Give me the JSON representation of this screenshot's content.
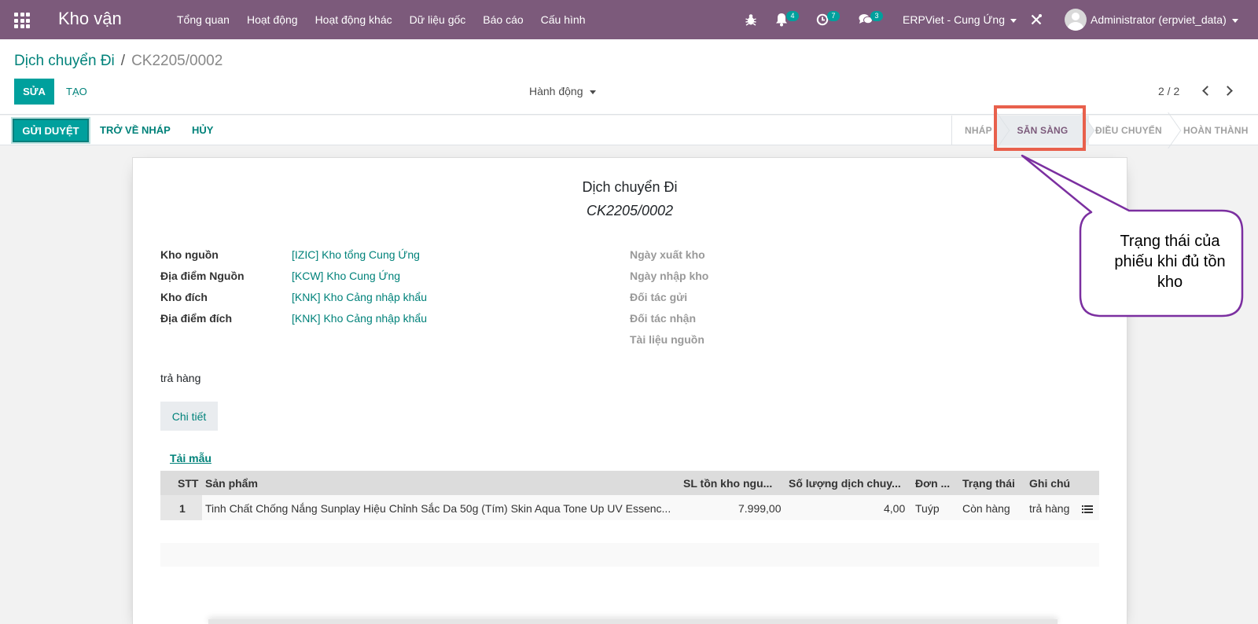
{
  "navbar": {
    "brand": "Kho vận",
    "menu": [
      "Tổng quan",
      "Hoạt động",
      "Hoạt động khác",
      "Dữ liệu gốc",
      "Báo cáo",
      "Cấu hình"
    ],
    "notifications_count": "4",
    "activities_count": "7",
    "messages_count": "3",
    "company": "ERPViet - Cung Ứng",
    "user": "Administrator (erpviet_data)"
  },
  "breadcrumb": {
    "parent": "Dịch chuyển Đi",
    "separator": "/",
    "current": "CK2205/0002"
  },
  "toolbar": {
    "edit": "SỬA",
    "create": "TẠO",
    "action": "Hành động",
    "pager": "2 / 2"
  },
  "statusbar": {
    "submit": "GỬI DUYỆT",
    "back_to_draft": "TRỞ VỀ NHÁP",
    "cancel": "HỦY",
    "stages": [
      "NHÁP",
      "SẴN SÀNG",
      "ĐIỀU CHUYỂN",
      "HOÀN THÀNH"
    ],
    "active_stage": "SẴN SÀNG"
  },
  "sheet": {
    "title": "Dịch chuyển Đi",
    "reference": "CK2205/0002",
    "left_fields": [
      {
        "label": "Kho nguồn",
        "value": "[IZIC] Kho tổng Cung Ứng"
      },
      {
        "label": "Địa điểm Nguồn",
        "value": "[KCW] Kho Cung Ứng"
      },
      {
        "label": "Kho đích",
        "value": "[KNK] Kho Cảng nhập khẩu"
      },
      {
        "label": "Địa điểm đích",
        "value": "[KNK] Kho Cảng nhập khẩu"
      }
    ],
    "right_fields": [
      "Ngày xuất kho",
      "Ngày nhập kho",
      "Đối tác gửi",
      "Đối tác nhận",
      "Tài liệu nguồn"
    ],
    "note": "trả hàng",
    "detail_button": "Chi tiết",
    "template_link": "Tải mẫu",
    "table": {
      "headers": [
        "STT",
        "Sản phẩm",
        "SL tồn kho ngu...",
        "Số lượng dịch chuy...",
        "Đơn ...",
        "Trạng thái",
        "Ghi chú"
      ],
      "rows": [
        {
          "stt": "1",
          "product": "Tinh Chất Chống Nắng Sunplay Hiệu Chỉnh Sắc Da 50g (Tím) Skin Aqua Tone Up UV Essenc...",
          "stock_qty": "7.999,00",
          "move_qty": "4,00",
          "uom": "Tuýp",
          "status": "Còn hàng",
          "note": "trả hàng"
        }
      ]
    }
  },
  "callout": {
    "text": "Trạng thái của phiếu khi đủ tồn kho"
  },
  "colors": {
    "navbar": "#7c5a7b",
    "primary": "#00a09d",
    "link": "#00827a",
    "highlight": "#e8604c",
    "callout_border": "#7b2fa0"
  }
}
